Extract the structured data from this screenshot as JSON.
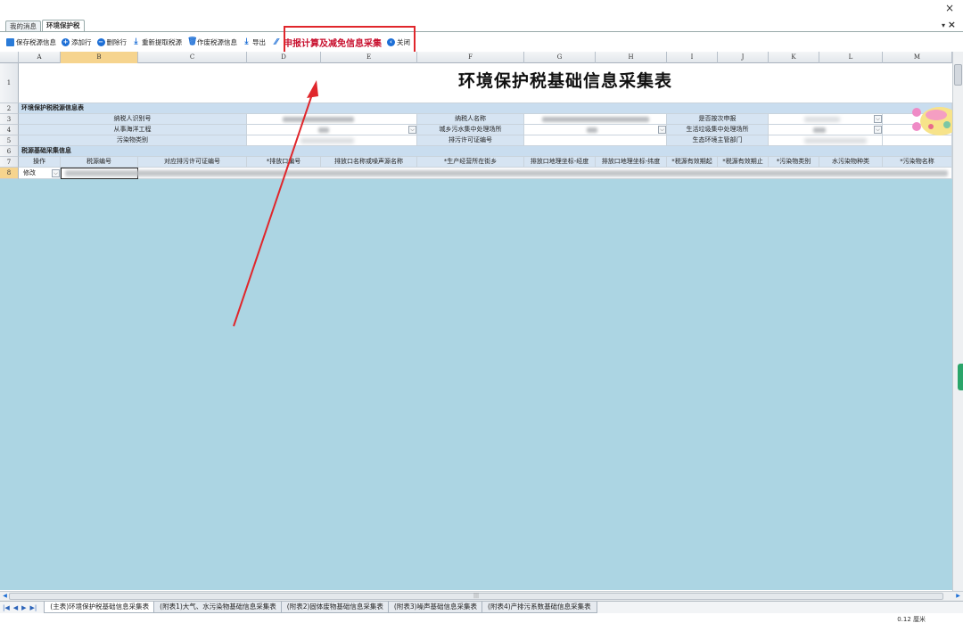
{
  "window": {
    "close_glyph": "×",
    "tab_menu_glyph": "▾",
    "tab_close_glyph": "×"
  },
  "tabs": [
    {
      "label": "我的消息",
      "active": false
    },
    {
      "label": "环境保护税",
      "active": true
    }
  ],
  "toolbar": {
    "save": "保存税源信息",
    "add_row": "添加行",
    "delete_row": "删除行",
    "refetch": "重新提取税源",
    "void": "作废税源信息",
    "export": "导出",
    "calc": "申报计算及减免信息采集",
    "close": "关闭"
  },
  "columns": [
    "A",
    "B",
    "C",
    "D",
    "E",
    "F",
    "G",
    "H",
    "I",
    "J",
    "K",
    "L",
    "M"
  ],
  "rows": [
    "1",
    "2",
    "3",
    "4",
    "5",
    "6",
    "7",
    "8"
  ],
  "sheet": {
    "title": "环境保护税基础信息采集表",
    "section1": "环境保护税税源信息表",
    "taxpayer_id_label": "纳税人识别号",
    "taxpayer_name_label": "纳税人名称",
    "quarterly_label": "是否按次申报",
    "marine_label": "从事海洋工程",
    "sewage_label": "城乡污水集中处理场所",
    "garbage_label": "生活垃圾集中处理场所",
    "pollutant_type_label": "污染物类别",
    "permit_label": "排污许可证编号",
    "eco_dept_label": "生态环境主管部门",
    "section2": "税源基础采集信息",
    "headers": [
      "操作",
      "税源编号",
      "对应排污许可证编号",
      "*排放口编号",
      "排放口名称或噪声源名称",
      "*生产经营所在街乡",
      "排放口地理坐标-经度",
      "排放口地理坐标-纬度",
      "*税源有效期起",
      "*税源有效期止",
      "*污染物类别",
      "水污染物种类",
      "*污染物名称"
    ],
    "row8_op": "修改"
  },
  "sheet_tabs": [
    "(主表)环境保护税基础信息采集表",
    "(附表1)大气、水污染物基础信息采集表",
    "(附表2)固体废物基础信息采集表",
    "(附表3)噪声基础信息采集表",
    "(附表4)产排污系数基础信息采集表"
  ],
  "bottom_fragment": "0.12 厘米",
  "colors": {
    "highlight": "#c8102e",
    "annotation": "#e0262b",
    "sheet_bg": "#acd5e3",
    "label_bg": "#d6e4f2"
  }
}
